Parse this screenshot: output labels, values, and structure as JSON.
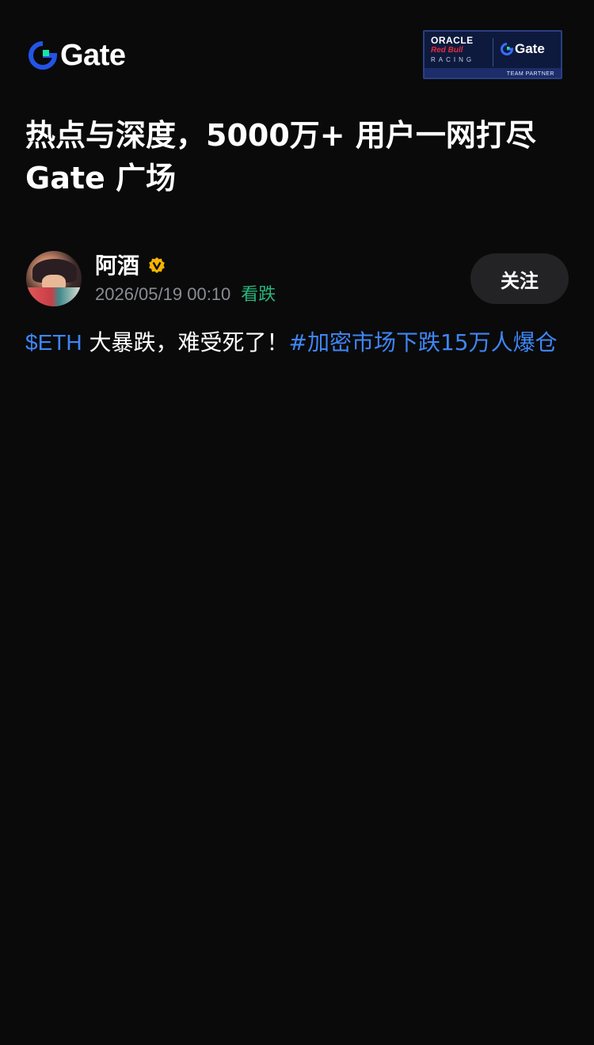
{
  "header": {
    "logo_text": "Gate",
    "partner": {
      "oracle": "ORACLE",
      "redbull": "Red Bull",
      "racing": "RACING",
      "gate": "Gate",
      "band": "TEAM PARTNER"
    }
  },
  "headline": {
    "line1": "热点与深度，5000万+ 用户一网打尽",
    "line2": "Gate 广场"
  },
  "post": {
    "author": "阿酒",
    "verified_icon": "verified-badge-icon",
    "time": "2026/05/19 00:10",
    "sentiment": "看跌",
    "follow_label": "关注",
    "ticker": "$ETH",
    "text": " 大暴跌，难受死了！",
    "hashtag": "#加密市场下跌15万人爆仓"
  },
  "colors": {
    "background": "#0a0a0b",
    "link_blue": "#3f86f5",
    "bearish_green": "#2bb57a",
    "follow_bg": "#232326",
    "verified_gold": "#f5b400"
  }
}
